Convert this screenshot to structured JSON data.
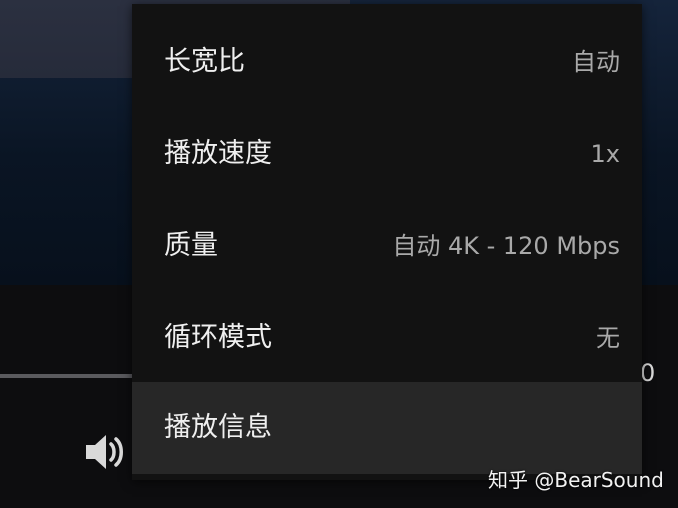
{
  "player": {
    "time_fragment": "0"
  },
  "settings_menu": {
    "items": [
      {
        "label": "长宽比",
        "value": "自动",
        "active": false
      },
      {
        "label": "播放速度",
        "value": "1x",
        "active": false
      },
      {
        "label": "质量",
        "value": "自动 4K - 120 Mbps",
        "active": false
      },
      {
        "label": "循环模式",
        "value": "无",
        "active": false
      },
      {
        "label": "播放信息",
        "value": "",
        "active": true
      }
    ]
  },
  "watermark": {
    "text": "知乎 @BearSound"
  },
  "icons": {
    "volume": "speaker-volume-icon"
  },
  "colors": {
    "menu_bg": "#121212",
    "menu_active_bg": "#272727",
    "label_text": "#efefef",
    "value_text": "#a9a9a9"
  }
}
